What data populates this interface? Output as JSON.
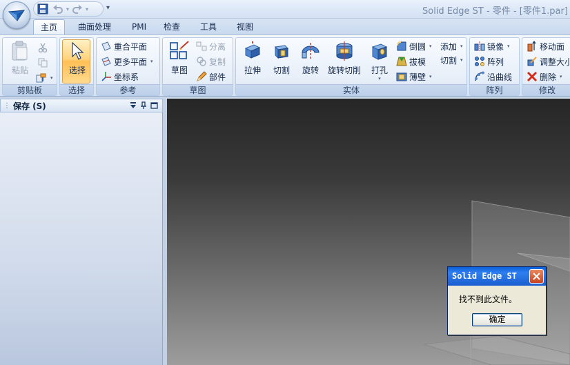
{
  "window": {
    "title": "Solid Edge ST - 零件 - [零件1.par]"
  },
  "qat": {
    "more_symbol": "▾"
  },
  "tabs": [
    {
      "label": "主页",
      "active": true
    },
    {
      "label": "曲面处理"
    },
    {
      "label": "PMI"
    },
    {
      "label": "检查"
    },
    {
      "label": "工具"
    },
    {
      "label": "视图"
    }
  ],
  "ribbon": {
    "clipboard": {
      "label": "剪贴板",
      "paste": "粘贴"
    },
    "select": {
      "label": "选择",
      "select": "选择"
    },
    "reference": {
      "label": "参考",
      "coincident_plane": "重合平面",
      "more_planes": "更多平面",
      "coord_system": "坐标系"
    },
    "sketch": {
      "label": "草图",
      "sketch": "草图",
      "separate": "分离",
      "copy": "复制",
      "part": "部件"
    },
    "solid": {
      "label": "实体",
      "extrude": "拉伸",
      "cut": "切割",
      "revolve": "旋转",
      "revolve_cut": "旋转切削",
      "hole": "打孔",
      "round": "倒圆",
      "draft": "拔模",
      "thin_wall": "薄壁",
      "add": "添加",
      "cut_menu": "切割"
    },
    "pattern": {
      "label": "阵列",
      "mirror": "镜像",
      "pattern": "阵列",
      "along_curve": "沿曲线"
    },
    "modify": {
      "label": "修改",
      "move_face": "移动面",
      "resize": "调整大小",
      "delete": "删除"
    }
  },
  "panel": {
    "title": "保存 (S)"
  },
  "dialog": {
    "title": "Solid Edge ST",
    "message": "找不到此文件。",
    "ok": "确定"
  },
  "colors": {
    "ribbon_accent": "#ffd27c",
    "dialog_title": "#1a5dcf",
    "dialog_close": "#c9461f"
  }
}
